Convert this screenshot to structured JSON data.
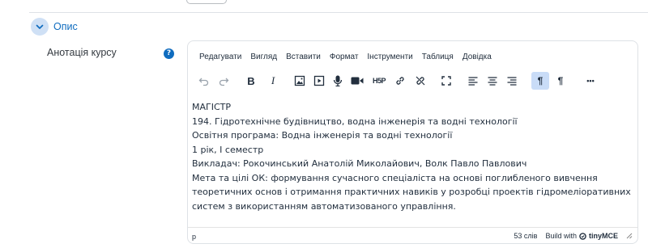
{
  "section": {
    "title": "Опис"
  },
  "field": {
    "label": "Анотація курсу",
    "help_icon": "question-circle-icon"
  },
  "editor": {
    "menu": [
      "Редагувати",
      "Вигляд",
      "Вставити",
      "Формат",
      "Інструменти",
      "Таблиця",
      "Довідка"
    ],
    "toolbar_icons": [
      "undo-icon",
      "redo-icon",
      "bold-icon",
      "italic-icon",
      "image-icon",
      "media-icon",
      "record-audio-icon",
      "record-video-icon",
      "h5p-icon",
      "link-icon",
      "unlink-icon",
      "fullscreen-icon",
      "align-left-icon",
      "align-center-icon",
      "align-right-icon",
      "ltr-icon",
      "rtl-icon",
      "more-icon"
    ],
    "toolbar_text": {
      "bold": "B",
      "italic": "I",
      "h5p": "H5P",
      "ltr": "¶",
      "rtl": "¶",
      "more": "•••"
    },
    "paragraphs": [
      "МАГІСТР",
      "194. Гідротехнічне будівництво, водна інженерія та водні технології",
      "Освітня програма: Водна інженерія та водні технології",
      "1 рік, І семестр",
      "Викладач: Рокочинський Анатолій Миколайович, Волк Павло Павлович",
      "Мета та цілі ОК: формування сучасного спеціаліста на основі поглибленого вивчення теоретичних основ і отримання практичних навиків у розробці проектів гідромеліоративних систем з використанням автоматизованого управління."
    ],
    "status": {
      "path": "p",
      "word_count": "53 слів",
      "build_with": "Build with",
      "brand": "tinyMCE"
    }
  }
}
